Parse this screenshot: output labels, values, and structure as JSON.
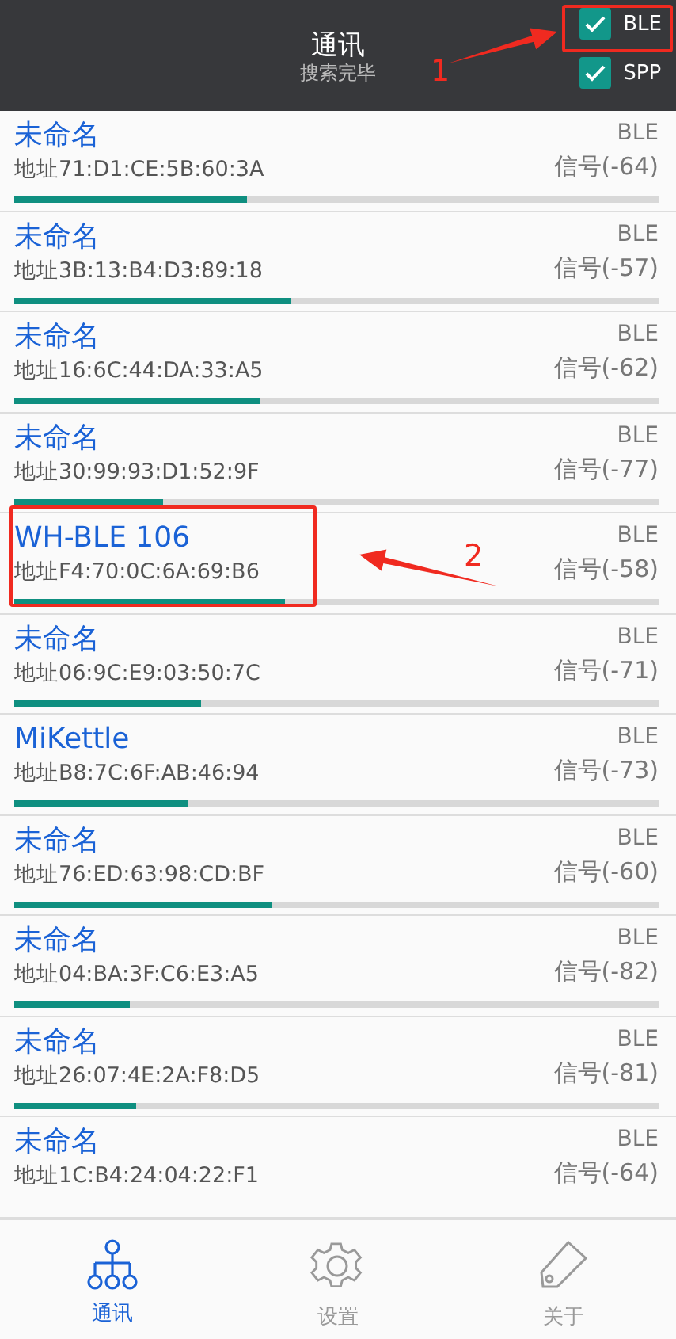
{
  "header": {
    "title": "通讯",
    "subtitle": "搜索完毕",
    "filters": [
      {
        "label": "BLE",
        "checked": true
      },
      {
        "label": "SPP",
        "checked": true
      }
    ]
  },
  "devices": [
    {
      "name": "未命名",
      "address": "地址71:D1:CE:5B:60:3A",
      "type": "BLE",
      "signal": "信号(-64)",
      "level": 0.36
    },
    {
      "name": "未命名",
      "address": "地址3B:13:B4:D3:89:18",
      "type": "BLE",
      "signal": "信号(-57)",
      "level": 0.43
    },
    {
      "name": "未命名",
      "address": "地址16:6C:44:DA:33:A5",
      "type": "BLE",
      "signal": "信号(-62)",
      "level": 0.38
    },
    {
      "name": "未命名",
      "address": "地址30:99:93:D1:52:9F",
      "type": "BLE",
      "signal": "信号(-77)",
      "level": 0.23
    },
    {
      "name": "WH-BLE 106",
      "address": "地址F4:70:0C:6A:69:B6",
      "type": "BLE",
      "signal": "信号(-58)",
      "level": 0.42
    },
    {
      "name": "未命名",
      "address": "地址06:9C:E9:03:50:7C",
      "type": "BLE",
      "signal": "信号(-71)",
      "level": 0.29
    },
    {
      "name": "MiKettle",
      "address": "地址B8:7C:6F:AB:46:94",
      "type": "BLE",
      "signal": "信号(-73)",
      "level": 0.27
    },
    {
      "name": "未命名",
      "address": "地址76:ED:63:98:CD:BF",
      "type": "BLE",
      "signal": "信号(-60)",
      "level": 0.4
    },
    {
      "name": "未命名",
      "address": "地址04:BA:3F:C6:E3:A5",
      "type": "BLE",
      "signal": "信号(-82)",
      "level": 0.18
    },
    {
      "name": "未命名",
      "address": "地址26:07:4E:2A:F8:D5",
      "type": "BLE",
      "signal": "信号(-81)",
      "level": 0.19
    },
    {
      "name": "未命名",
      "address": "地址1C:B4:24:04:22:F1",
      "type": "BLE",
      "signal": "信号(-64)"
    }
  ],
  "nav": [
    {
      "label": "通讯",
      "kind": "network",
      "selected": true
    },
    {
      "label": "设置",
      "kind": "settings",
      "selected": false
    },
    {
      "label": "关于",
      "kind": "tag",
      "selected": false
    }
  ],
  "annotations": [
    {
      "label": "1"
    },
    {
      "label": "2"
    }
  ]
}
